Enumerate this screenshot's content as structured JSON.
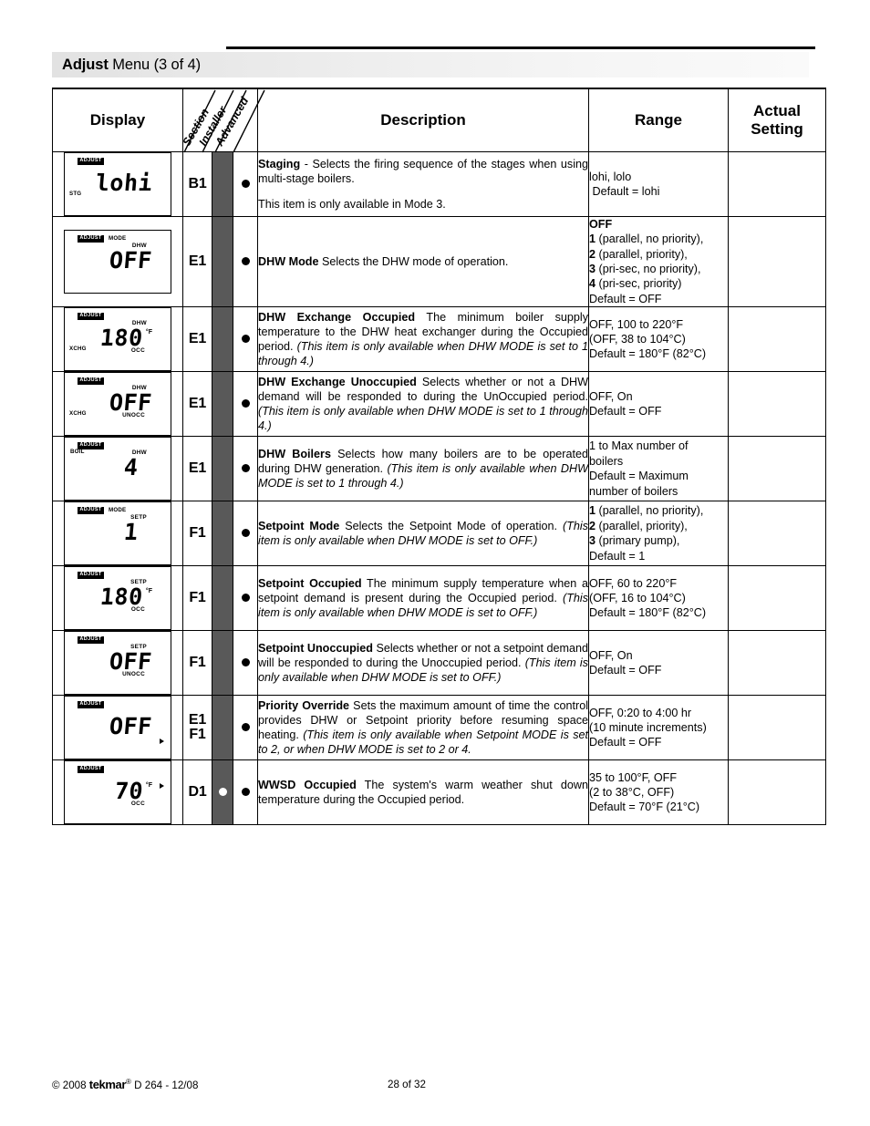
{
  "header": {
    "title_strong": "Adjust",
    "title_rest": " Menu (3 of 4)"
  },
  "table": {
    "columns": {
      "display": "Display",
      "section": "Section",
      "installer": "Installer",
      "advanced": "Advanced",
      "description": "Description",
      "range": "Range",
      "actual_setting_line1": "Actual",
      "actual_setting_line2": "Setting"
    },
    "colors": {
      "installer_column": "#595959",
      "title_bar_gradient_start": "#e2e2e2",
      "title_bar_gradient_end": "#fafafa"
    },
    "rows": [
      {
        "id": "staging",
        "lcd": {
          "badge": "ADJUST",
          "mode": "",
          "top_left": "",
          "bottom_left": "STG",
          "top_label": "",
          "bottom_label": "",
          "value": "lohi",
          "unit": "",
          "arrow": false
        },
        "section": "B1",
        "installer_dot": "none",
        "advanced_dot": "filled",
        "description": [
          {
            "bold": "Staging",
            "text": " - Selects the firing sequence of the stages when using multi-stage boilers."
          },
          {
            "bold": "",
            "text": "This item is only available in Mode 3."
          }
        ],
        "range": [
          {
            "text": "lohi, lolo"
          },
          {
            "text": " Default = lohi"
          }
        ],
        "actual_setting": ""
      },
      {
        "id": "dhw-mode",
        "lcd": {
          "badge": "ADJUST",
          "mode": "MODE",
          "top_left": "",
          "bottom_left": "",
          "top_label": "DHW",
          "bottom_label": "",
          "value": "OFF",
          "unit": "",
          "arrow": false
        },
        "section": "E1",
        "installer_dot": "none",
        "advanced_dot": "filled",
        "description": [
          {
            "bold": "DHW Mode",
            "text": " Selects the DHW mode of operation."
          }
        ],
        "range": [
          {
            "bold": "OFF",
            "text": ""
          },
          {
            "bold": "1",
            "text": " (parallel, no priority),"
          },
          {
            "bold": "2",
            "text": " (parallel, priority),"
          },
          {
            "bold": "3",
            "text": " (pri-sec, no priority),"
          },
          {
            "bold": "4",
            "text": " (pri-sec, priority)"
          },
          {
            "text": "Default = OFF"
          }
        ],
        "actual_setting": ""
      },
      {
        "id": "dhw-exchange-occupied",
        "lcd": {
          "badge": "ADJUST",
          "mode": "",
          "top_left": "",
          "bottom_left": "XCHG",
          "top_label": "DHW",
          "bottom_label": "OCC",
          "value": "180",
          "unit": "°F",
          "arrow": false
        },
        "section": "E1",
        "installer_dot": "none",
        "advanced_dot": "filled",
        "description": [
          {
            "bold": "DHW Exchange Occupied",
            "text": " The minimum boiler supply temperature to the DHW heat exchanger during the Occupied period. ",
            "italic": "(This item is only available when DHW MODE is set to 1 through 4.)"
          }
        ],
        "range": [
          {
            "text": "OFF, 100 to 220°F"
          },
          {
            "text": "(OFF, 38 to 104°C)"
          },
          {
            "text": "Default = 180°F (82°C)"
          }
        ],
        "actual_setting": ""
      },
      {
        "id": "dhw-exchange-unoccupied",
        "lcd": {
          "badge": "ADJUST",
          "mode": "",
          "top_left": "",
          "bottom_left": "XCHG",
          "top_label": "DHW",
          "bottom_label": "UNOCC",
          "value": "OFF",
          "unit": "",
          "arrow": false
        },
        "section": "E1",
        "installer_dot": "none",
        "advanced_dot": "filled",
        "description": [
          {
            "bold": "DHW Exchange Unoccupied",
            "text": " Selects whether or not a DHW demand will be responded to during the UnOccupied period. ",
            "italic": "(This item is only available when DHW MODE is set to 1 through 4.)"
          }
        ],
        "range": [
          {
            "text": "OFF, On"
          },
          {
            "text": "Default = OFF"
          }
        ],
        "actual_setting": ""
      },
      {
        "id": "dhw-boilers",
        "lcd": {
          "badge": "ADJUST",
          "mode": "",
          "top_left": "BOIL",
          "bottom_left": "",
          "top_label": "DHW",
          "bottom_label": "",
          "value": "4",
          "unit": "",
          "arrow": false
        },
        "section": "E1",
        "installer_dot": "none",
        "advanced_dot": "filled",
        "description": [
          {
            "bold": "DHW Boilers",
            "text": " Selects how many boilers are to be operated during DHW generation. ",
            "italic": "(This item is only available when DHW MODE is set to 1 through 4.)"
          }
        ],
        "range": [
          {
            "text": "1 to Max number of"
          },
          {
            "text": "boilers"
          },
          {
            "text": "Default = Maximum"
          },
          {
            "text": "number of boilers"
          }
        ],
        "actual_setting": ""
      },
      {
        "id": "setpoint-mode",
        "lcd": {
          "badge": "ADJUST",
          "mode": "MODE",
          "top_left": "",
          "bottom_left": "",
          "top_label": "SETP",
          "bottom_label": "",
          "value": "1",
          "unit": "",
          "arrow": false
        },
        "section": "F1",
        "installer_dot": "none",
        "advanced_dot": "filled",
        "description": [
          {
            "bold": "Setpoint Mode",
            "text": " Selects the Setpoint Mode of operation. ",
            "italic": "(This item is only available when DHW MODE is set to OFF.)"
          }
        ],
        "range": [
          {
            "bold": "1",
            "text": " (parallel, no priority),"
          },
          {
            "bold": "2",
            "text": " (parallel, priority),"
          },
          {
            "bold": "3",
            "text": " (primary pump),"
          },
          {
            "text": "Default = 1"
          }
        ],
        "actual_setting": ""
      },
      {
        "id": "setpoint-occupied",
        "lcd": {
          "badge": "ADJUST",
          "mode": "",
          "top_left": "",
          "bottom_left": "",
          "top_label": "SETP",
          "bottom_label": "OCC",
          "value": "180",
          "unit": "°F",
          "arrow": false
        },
        "section": "F1",
        "installer_dot": "none",
        "advanced_dot": "filled",
        "description": [
          {
            "bold": "Setpoint Occupied",
            "text": " The minimum supply temperature when a setpoint demand is present during the Occupied period. ",
            "italic": "(This item is only available when DHW MODE is set to OFF.)"
          }
        ],
        "range": [
          {
            "text": "OFF, 60 to 220°F"
          },
          {
            "text": "(OFF, 16 to 104°C)"
          },
          {
            "text": "Default = 180°F (82°C)"
          }
        ],
        "actual_setting": ""
      },
      {
        "id": "setpoint-unoccupied",
        "lcd": {
          "badge": "ADJUST",
          "mode": "",
          "top_left": "",
          "bottom_left": "",
          "top_label": "SETP",
          "bottom_label": "UNOCC",
          "value": "OFF",
          "unit": "",
          "arrow": false
        },
        "section": "F1",
        "installer_dot": "none",
        "advanced_dot": "filled",
        "description": [
          {
            "bold": "Setpoint Unoccupied",
            "text": " Selects whether or not a setpoint demand will be responded to during the Unoccupied period. ",
            "italic": "(This item is only available when DHW MODE is set to OFF.)"
          }
        ],
        "range": [
          {
            "text": "OFF, On"
          },
          {
            "text": "Default = OFF"
          }
        ],
        "actual_setting": ""
      },
      {
        "id": "priority-override",
        "lcd": {
          "badge": "ADJUST",
          "mode": "",
          "top_left": "",
          "bottom_left": "",
          "top_label": "",
          "bottom_label": "",
          "value": "OFF",
          "unit": "",
          "arrow": true
        },
        "section": "E1\nF1",
        "installer_dot": "none",
        "advanced_dot": "filled",
        "description": [
          {
            "bold": "Priority Override",
            "text": " Sets the maximum amount of time the control provides DHW or Setpoint priority before resuming space heating. ",
            "italic": "(This item is only available when Setpoint MODE is set to 2, or when DHW MODE is set to 2 or 4."
          }
        ],
        "range": [
          {
            "text": "OFF, 0:20 to 4:00 hr"
          },
          {
            "text": "(10 minute increments)"
          },
          {
            "text": "Default = OFF"
          }
        ],
        "actual_setting": ""
      },
      {
        "id": "wwsd-occupied",
        "lcd": {
          "badge": "ADJUST",
          "mode": "",
          "top_left": "",
          "bottom_left": "",
          "top_label": "",
          "bottom_label": "OCC",
          "value": "70",
          "unit": "°F",
          "arrow": true
        },
        "section": "D1",
        "installer_dot": "hollow",
        "advanced_dot": "filled",
        "description": [
          {
            "bold": "WWSD Occupied",
            "text": " The system's warm weather shut down temperature during the Occupied period."
          }
        ],
        "range": [
          {
            "text": "35 to 100°F, OFF"
          },
          {
            "text": "(2 to 38°C, OFF)"
          },
          {
            "text": "Default = 70°F (21°C)"
          }
        ],
        "actual_setting": ""
      }
    ]
  },
  "footer": {
    "copyright": "© 2008 ",
    "brand": "tekmar",
    "brand_sup": "®",
    "doc": " D 264 - 12/08",
    "page": "28 of 32"
  }
}
